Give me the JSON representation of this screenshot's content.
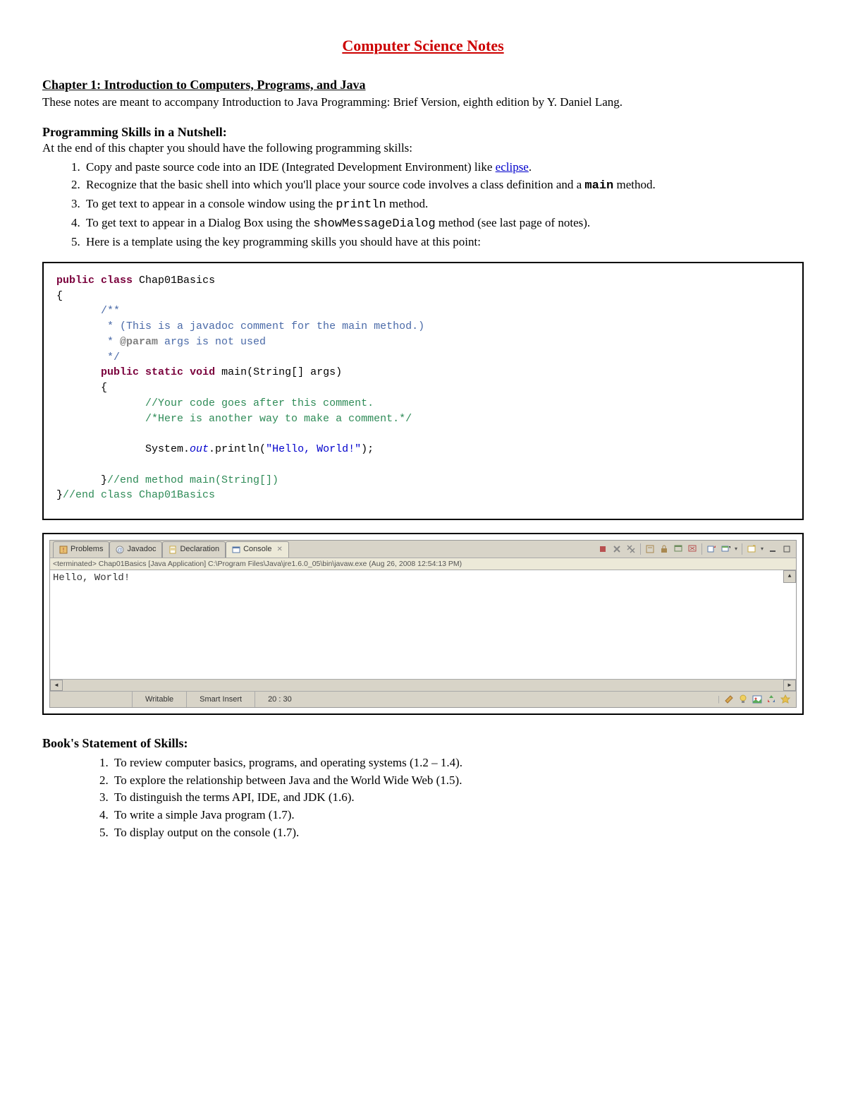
{
  "title": "Computer Science Notes",
  "chapter": "Chapter 1: Introduction to Computers, Programs, and Java",
  "intro": "These notes are meant to accompany Introduction to Java Programming: Brief Version, eighth edition by Y. Daniel Lang.",
  "progSkillsHead": "Programming Skills in a Nutshell:",
  "progSkillsIntro": "At the end of this chapter you should have the following programming skills:",
  "skills": {
    "s1a": "Copy and paste source code into an IDE (Integrated Development Environment) like ",
    "s1link": "eclipse",
    "s1b": ".",
    "s2a": "Recognize that the basic shell into which you'll place your source code involves a class definition and a ",
    "s2mono": "main",
    "s2b": " method.",
    "s3a": "To get text to appear in a console window using the ",
    "s3mono": "println",
    "s3b": " method.",
    "s4a": "To get text to appear in a Dialog Box using the ",
    "s4mono": "showMessageDialog",
    "s4b": " method (see last page of notes).",
    "s5": "Here is a template using the key programming skills you should have at this point:"
  },
  "code": {
    "l1a": "public",
    "l1b": " ",
    "l1c": "class",
    "l1d": " Chap01Basics",
    "l2": "{",
    "l3": "       /**",
    "l4": "        * (This is a javadoc comment for the main method.)",
    "l5a": "        * ",
    "l5b": "@param",
    "l5c": " args is not used",
    "l6": "        */",
    "l7a": "       ",
    "l7b": "public",
    "l7c": " ",
    "l7d": "static",
    "l7e": " ",
    "l7f": "void",
    "l7g": " main(String[] args)",
    "l8": "       {",
    "l9": "              //Your code goes after this comment.",
    "l10": "              /*Here is another way to make a comment.*/",
    "l11": "",
    "l12a": "              System.",
    "l12b": "out",
    "l12c": ".println(",
    "l12d": "\"Hello, World!\"",
    "l12e": ");",
    "l13": "",
    "l14a": "       }",
    "l14b": "//end method main(String[])",
    "l15a": "}",
    "l15b": "//end class Chap01Basics"
  },
  "console": {
    "tabs": {
      "problems": "Problems",
      "javadoc": "Javadoc",
      "declaration": "Declaration",
      "console": "Console"
    },
    "terminated": "<terminated> Chap01Basics [Java Application] C:\\Program Files\\Java\\jre1.6.0_05\\bin\\javaw.exe (Aug 26, 2008 12:54:13 PM)",
    "output": "Hello, World!",
    "status": {
      "writable": "Writable",
      "insert": "Smart Insert",
      "pos": "20 : 30"
    }
  },
  "bookSkillsHead": "Book's Statement of Skills:",
  "bookSkills": {
    "b1": "To review computer basics, programs, and operating systems (1.2 – 1.4).",
    "b2": "To explore the relationship between Java and the World Wide Web (1.5).",
    "b3": "To distinguish the terms API, IDE, and JDK (1.6).",
    "b4": "To write a simple Java program (1.7).",
    "b5": "To display output on the console (1.7)."
  }
}
